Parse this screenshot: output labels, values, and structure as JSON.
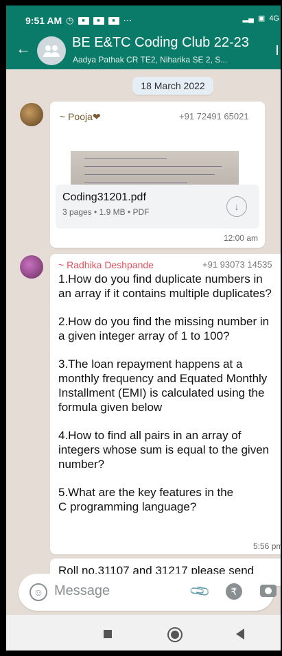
{
  "status_bar": {
    "time": "9:51 AM",
    "extra": "⋯",
    "network": "4G"
  },
  "chat_header": {
    "title": "BE E&TC Coding Club 22-23",
    "subtitle": "Aadya Pathak CR TE2, Niharika SE 2, S..."
  },
  "date_chip": "18 March 2022",
  "messages": [
    {
      "sender": "~ Pooja❤",
      "phone": "+91 72491 65021",
      "document": {
        "name": "Coding31201.pdf",
        "meta": "3 pages • 1.9 MB • PDF"
      },
      "time": "12:00 am"
    },
    {
      "sender": "~ Radhika Deshpande",
      "phone": "+91 93073 14535",
      "paragraphs": [
        "1.How do you find duplicate numbers in an array if it contains multiple duplicates?",
        "2.How do you find the missing number in a given integer array of 1 to 100?",
        "3.The loan repayment happens at a monthly frequency and Equated Monthly Installment (EMI) is calculated using the formula given below",
        "4.How to find all pairs in an array of integers whose sum is equal to the given number?",
        "5.What are the key features in the C programming language?"
      ],
      "time": "5:56 pm"
    },
    {
      "text": "Roll no.31107 and 31217 please send"
    }
  ],
  "composer": {
    "placeholder": "Message"
  },
  "colors": {
    "header": "#0a7b68",
    "chat_bg": "#e5ddd5",
    "sender2": "#e0505d"
  }
}
